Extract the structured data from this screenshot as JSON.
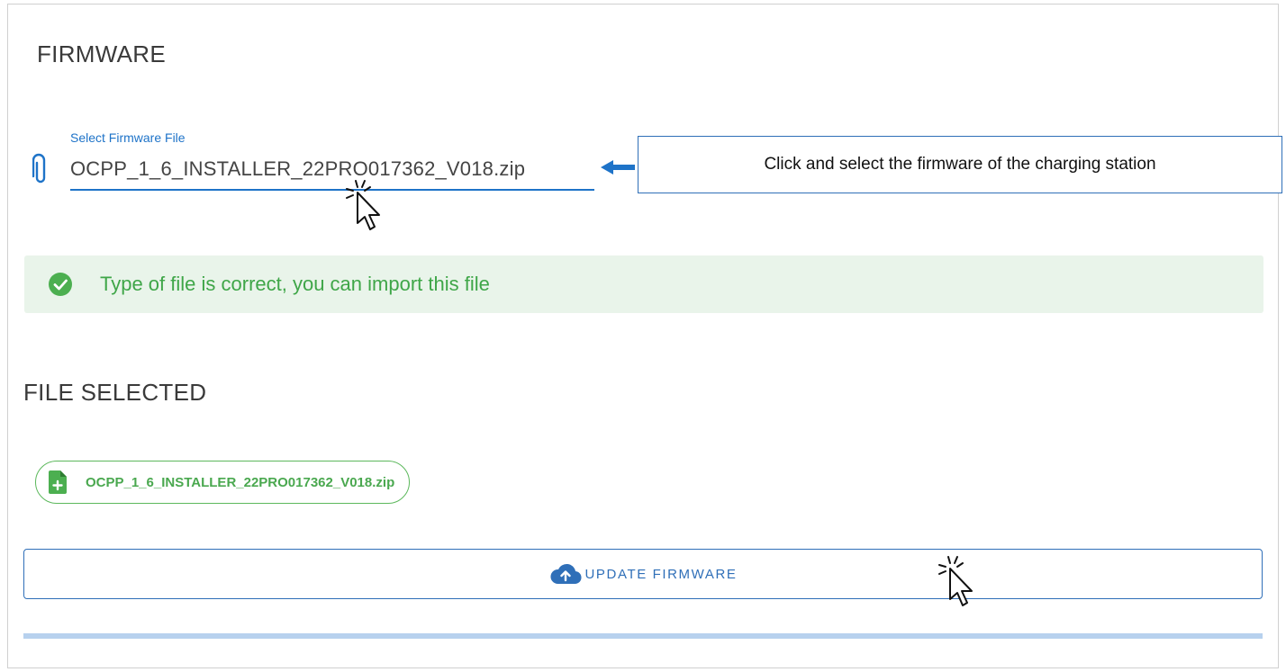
{
  "firmware_section": {
    "title": "FIRMWARE",
    "file_field": {
      "label": "Select Firmware File",
      "value": "OCPP_1_6_INSTALLER_22PRO017362_V018.zip"
    },
    "callout_text": "Click and select the firmware of the charging station"
  },
  "validation": {
    "message": "Type of file is correct, you can import this file",
    "status_color": "#3fa648"
  },
  "file_selected_section": {
    "title": "FILE SELECTED",
    "chip_label": "OCPP_1_6_INSTALLER_22PRO017362_V018.zip"
  },
  "actions": {
    "update_button_label": "UPDATE FIRMWARE"
  },
  "progress": {
    "fraction": 1.0
  },
  "colors": {
    "accent": "#1e73c8",
    "success": "#4aa84f",
    "success_bg": "#e9f4ea",
    "progress": "#b7d1ee"
  },
  "icons": {
    "field": "paperclip-icon",
    "validation": "check-circle-icon",
    "chip": "file-add-icon",
    "update": "cloud-upload-icon"
  }
}
